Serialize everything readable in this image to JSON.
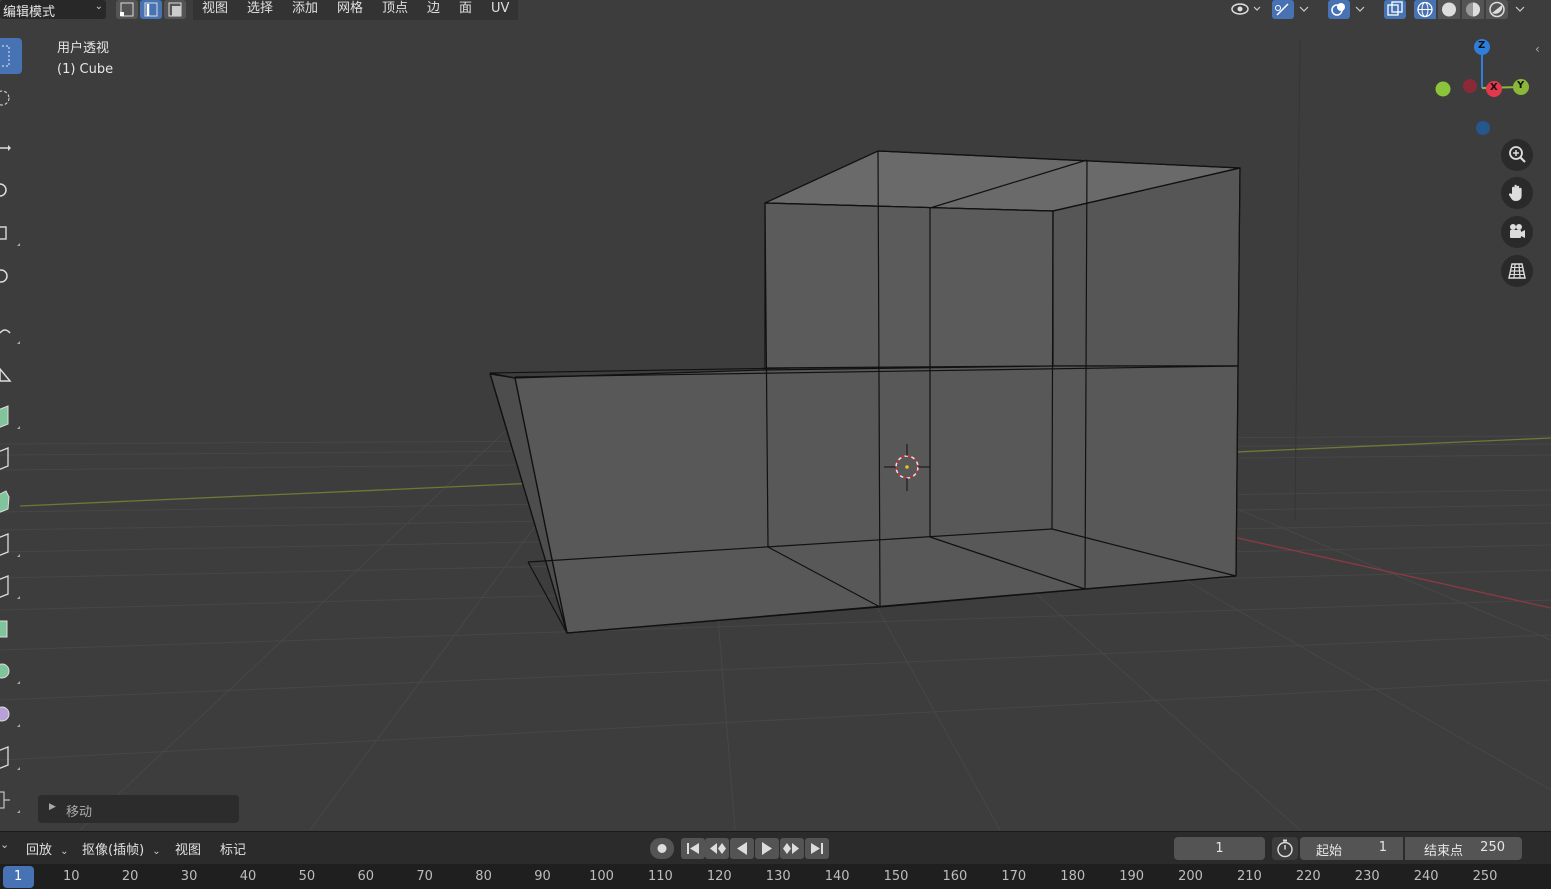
{
  "header": {
    "mode_label": "编辑模式",
    "menus": [
      "视图",
      "选择",
      "添加",
      "网格",
      "顶点",
      "边",
      "面",
      "UV"
    ]
  },
  "viewport": {
    "view_name": "用户透视",
    "object_label": "(1) Cube",
    "gizmo_axes": {
      "z": "Z",
      "x": "X",
      "y": "Y"
    },
    "colors": {
      "accent": "#4772b3",
      "x_axis": "#e2384e",
      "y_axis": "#8bb83a",
      "z_axis": "#2e7fdc"
    }
  },
  "operator_panel": {
    "label": "移动"
  },
  "timeline": {
    "playback_label": "回放",
    "keying_label": "抠像(插帧)",
    "view_label": "视图",
    "marker_label": "标记",
    "current_frame": "1",
    "start_label": "起始",
    "start_value": "1",
    "end_label": "结束点",
    "end_value": "250",
    "ruler_current": "1",
    "ruler_ticks": [
      "10",
      "20",
      "30",
      "40",
      "50",
      "60",
      "70",
      "80",
      "90",
      "100",
      "110",
      "120",
      "130",
      "140",
      "150",
      "160",
      "170",
      "180",
      "190",
      "200",
      "210",
      "220",
      "230",
      "240",
      "250"
    ]
  }
}
